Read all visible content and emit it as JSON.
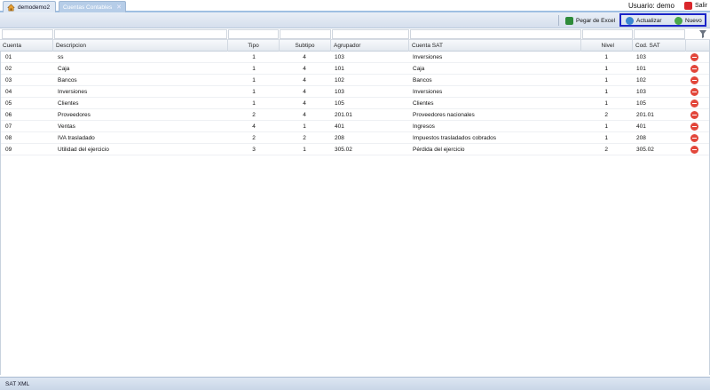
{
  "tabs": [
    {
      "label": "demodemo2"
    },
    {
      "label": "Cuentas Contables"
    }
  ],
  "user_label": "Usuario: demo",
  "logout_label": "Salir",
  "toolbar": {
    "excel_label": "Pegar de Excel",
    "refresh_label": "Actualizar",
    "new_label": "Nuevo"
  },
  "columns": {
    "cuenta": "Cuenta",
    "descripcion": "Descripcion",
    "tipo": "Tipo",
    "subtipo": "Subtipo",
    "agrupador": "Agrupador",
    "cuenta_sat": "Cuenta SAT",
    "nivel": "Nivel",
    "cod_sat": "Cod. SAT"
  },
  "rows": [
    {
      "cuenta": "01",
      "descripcion": "ss",
      "tipo": "1",
      "subtipo": "4",
      "agrupador": "103",
      "cuenta_sat": "Inversiones",
      "nivel": "1",
      "cod_sat": "103"
    },
    {
      "cuenta": "02",
      "descripcion": "Caja",
      "tipo": "1",
      "subtipo": "4",
      "agrupador": "101",
      "cuenta_sat": "Caja",
      "nivel": "1",
      "cod_sat": "101"
    },
    {
      "cuenta": "03",
      "descripcion": "Bancos",
      "tipo": "1",
      "subtipo": "4",
      "agrupador": "102",
      "cuenta_sat": "Bancos",
      "nivel": "1",
      "cod_sat": "102"
    },
    {
      "cuenta": "04",
      "descripcion": "Inversiones",
      "tipo": "1",
      "subtipo": "4",
      "agrupador": "103",
      "cuenta_sat": "Inversiones",
      "nivel": "1",
      "cod_sat": "103"
    },
    {
      "cuenta": "05",
      "descripcion": "Clientes",
      "tipo": "1",
      "subtipo": "4",
      "agrupador": "105",
      "cuenta_sat": "Clientes",
      "nivel": "1",
      "cod_sat": "105"
    },
    {
      "cuenta": "06",
      "descripcion": "Proveedores",
      "tipo": "2",
      "subtipo": "4",
      "agrupador": "201.01",
      "cuenta_sat": "Proveedores nacionales",
      "nivel": "2",
      "cod_sat": "201.01"
    },
    {
      "cuenta": "07",
      "descripcion": "Ventas",
      "tipo": "4",
      "subtipo": "1",
      "agrupador": "401",
      "cuenta_sat": "Ingresos",
      "nivel": "1",
      "cod_sat": "401"
    },
    {
      "cuenta": "08",
      "descripcion": "IVA trasladado",
      "tipo": "2",
      "subtipo": "2",
      "agrupador": "208",
      "cuenta_sat": "Impuestos trasladados cobrados",
      "nivel": "1",
      "cod_sat": "208"
    },
    {
      "cuenta": "09",
      "descripcion": "Utilidad del ejercicio",
      "tipo": "3",
      "subtipo": "1",
      "agrupador": "305.02",
      "cuenta_sat": "Pérdida del ejercicio",
      "nivel": "2",
      "cod_sat": "305.02"
    }
  ],
  "footer": {
    "label": "SAT XML"
  },
  "icons": {
    "home": "home-icon",
    "close": "close-icon",
    "logout": "logout-icon",
    "excel": "excel-icon",
    "refresh": "refresh-icon",
    "add": "add-icon",
    "filter": "filter-icon",
    "delete": "delete-icon"
  },
  "colors": {
    "accent": "#b6cde8",
    "highlight_border": "#1a24c8",
    "delete": "#e2463a"
  }
}
